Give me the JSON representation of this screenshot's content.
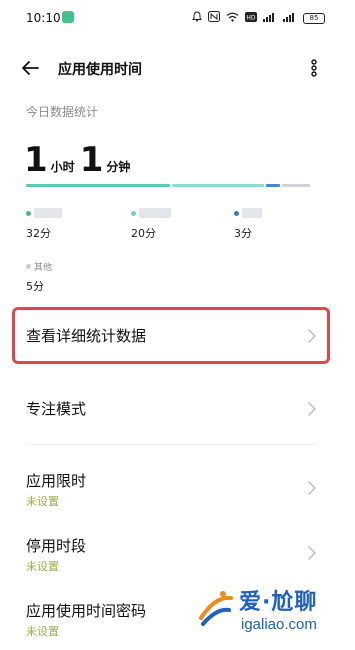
{
  "status_bar": {
    "time": "10:10",
    "icons": [
      "alarm-icon",
      "nfc-icon",
      "wifi-icon",
      "hd-icon",
      "signal-icon",
      "signal-icon",
      "battery-icon"
    ],
    "battery": "85"
  },
  "header": {
    "title": "应用使用时间"
  },
  "stats": {
    "section_label": "今日数据统计",
    "total_hours": "1",
    "hours_unit": "小时",
    "total_minutes": "1",
    "minutes_unit": "分钟",
    "bar_segments": [
      {
        "fraction": 0.52,
        "color": "#5dcab4"
      },
      {
        "fraction": 0.33,
        "color": "#8fdccd"
      },
      {
        "fraction": 0.05,
        "color": "#3d88d9"
      },
      {
        "fraction": 0.1,
        "color": "#cfd3d8"
      }
    ],
    "apps": [
      {
        "value": "32分",
        "color": "#3fb89e"
      },
      {
        "value": "20分",
        "color": "#6fd1c0"
      },
      {
        "value": "3分",
        "color": "#2f7bd8"
      }
    ],
    "other": {
      "name": "其他",
      "value": "5分",
      "color": "#c9cdd2"
    }
  },
  "menu": {
    "detail": {
      "label": "查看详细统计数据"
    },
    "focus": {
      "label": "专注模式"
    },
    "app_limit": {
      "label": "应用限时",
      "sub": "未设置"
    },
    "downtime": {
      "label": "停用时段",
      "sub": "未设置"
    },
    "password": {
      "label": "应用使用时间密码",
      "sub": "未设置"
    }
  },
  "watermark": {
    "brand_cn": "爱·尬聊",
    "url": "igaliao.com"
  },
  "colors": {
    "highlight": "#e0474c",
    "sub_text": "#9ab04a",
    "watermark": "#1f5fbf"
  }
}
